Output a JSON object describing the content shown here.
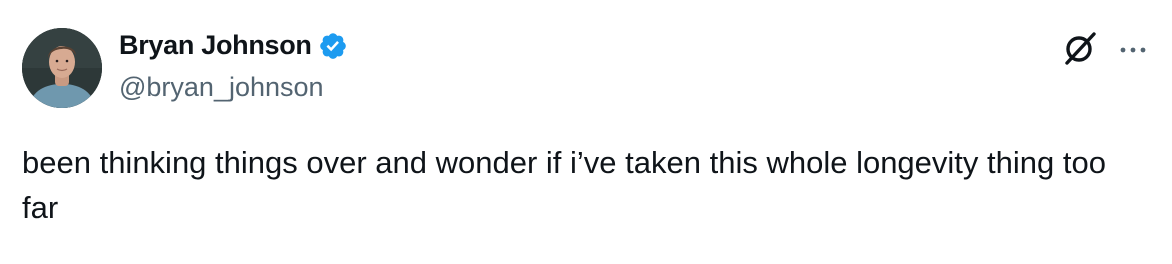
{
  "author": {
    "display_name": "Bryan Johnson",
    "handle": "@bryan_johnson",
    "verified": true
  },
  "tweet": {
    "text": "been thinking things over and wonder if i’ve taken this whole longevity thing too far"
  },
  "icons": {
    "verified": "verified-badge-icon",
    "grok": "grok-icon",
    "more": "more-options-icon"
  },
  "colors": {
    "text_primary": "#0f1419",
    "text_secondary": "#536471",
    "verified_blue": "#1d9bf0"
  }
}
